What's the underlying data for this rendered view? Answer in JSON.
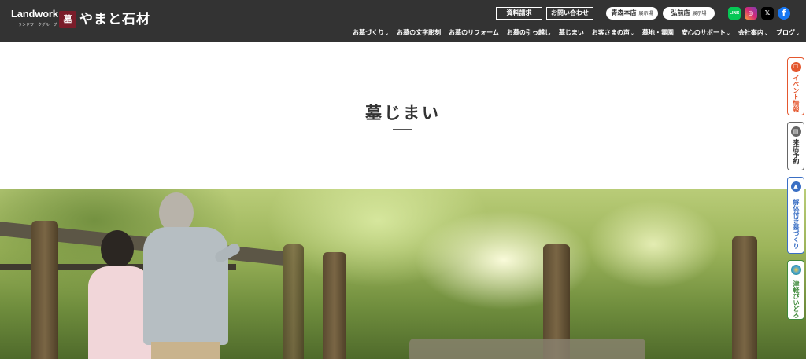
{
  "brand": {
    "landwork": "Landwork",
    "group": "ランドワークグループ",
    "seal": "墓",
    "company": "やまと石材"
  },
  "header_buttons": {
    "request_materials": "資料請求",
    "contact": "お問い合わせ"
  },
  "branches": [
    {
      "name": "青森本店",
      "sub": "展示場"
    },
    {
      "name": "弘前店",
      "sub": "展示場"
    }
  ],
  "social": [
    {
      "icon": "line-icon",
      "glyph": "LINE",
      "color": "#06c755"
    },
    {
      "icon": "instagram-icon",
      "glyph": "◎",
      "color": "#d62976"
    },
    {
      "icon": "x-icon",
      "glyph": "𝕏",
      "color": "#000000"
    },
    {
      "icon": "facebook-icon",
      "glyph": "f",
      "color": "#1877f2"
    }
  ],
  "nav": [
    {
      "label": "お墓づくり",
      "dropdown": true
    },
    {
      "label": "お墓の文字彫刻",
      "dropdown": false
    },
    {
      "label": "お墓のリフォーム",
      "dropdown": false
    },
    {
      "label": "お墓の引っ越し",
      "dropdown": false
    },
    {
      "label": "墓じまい",
      "dropdown": false
    },
    {
      "label": "お客さまの声",
      "dropdown": true
    },
    {
      "label": "墓地・霊園",
      "dropdown": false
    },
    {
      "label": "安心のサポート",
      "dropdown": true
    },
    {
      "label": "会社案内",
      "dropdown": true
    },
    {
      "label": "ブログ",
      "dropdown": true
    }
  ],
  "page": {
    "title": "墓じまい"
  },
  "side_tabs": [
    {
      "label": "イベント情報",
      "icon": "event-icon",
      "color": "#e4572e"
    },
    {
      "label": "来店予約",
      "icon": "shop-icon",
      "color": "#666666"
    },
    {
      "label": "解体付き墓づくり",
      "icon": "grave-icon",
      "color": "#3a6fc4"
    },
    {
      "label": "津軽びいどろ",
      "icon": "glass-icon",
      "color": "#3f8a3a"
    }
  ],
  "colors": {
    "header_bg": "#333333",
    "seal_red": "#7a1d2a"
  }
}
